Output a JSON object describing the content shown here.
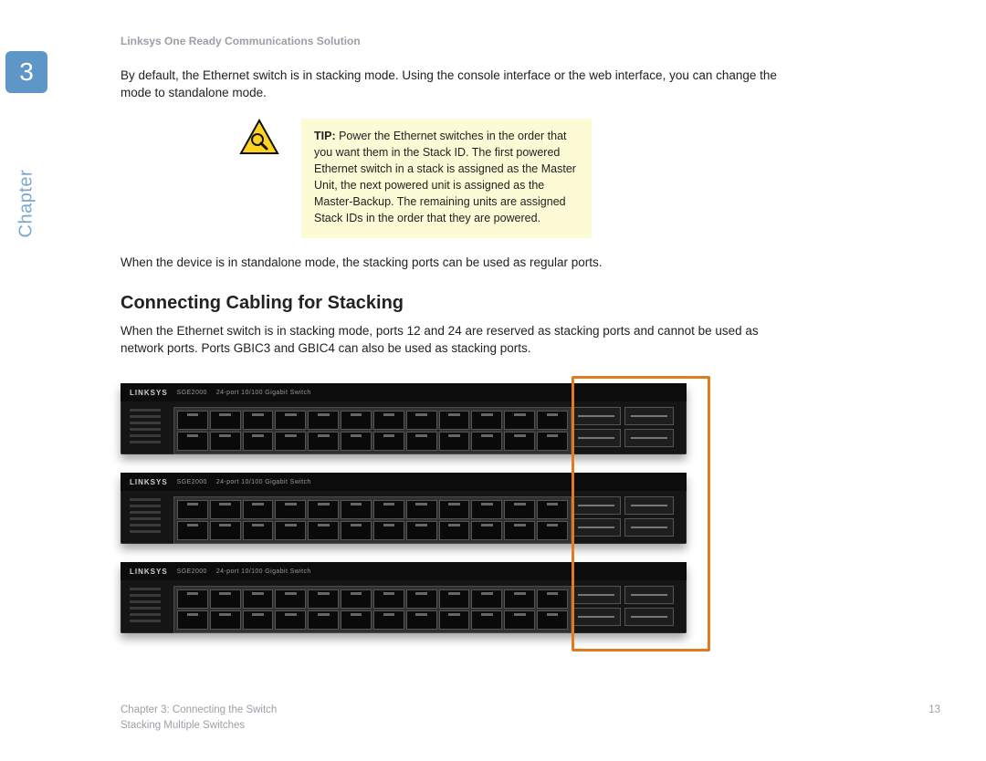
{
  "sideTab": {
    "chapterNumber": "3",
    "label": "Chapter"
  },
  "header": {
    "runningHead": "Linksys One Ready Communications Solution"
  },
  "body": {
    "intro": "By default, the Ethernet switch is in stacking mode. Using the console interface or the web interface, you can change the mode to standalone mode.",
    "tip": {
      "label": "TIP:",
      "text": "Power the Ethernet switches in the order that you want them in the Stack ID. The first powered Ethernet switch in a stack is assigned as the Master Unit, the next powered unit is assigned as the Master-Backup. The remaining units are assigned Stack IDs in the order that they are powered."
    },
    "standalone": "When the device is in standalone mode, the stacking ports can be used as regular ports.",
    "sectionTitle": "Connecting Cabling for Stacking",
    "sectionBody": "When the Ethernet switch is in stacking mode, ports 12 and 24 are reserved as stacking ports and cannot be used as network ports. Ports GBIC3 and GBIC4 can also be used as stacking ports."
  },
  "switchLabel": {
    "brand": "LINKSYS",
    "model": "SGE2000",
    "desc": "24-port 10/100 Gigabit Switch"
  },
  "footer": {
    "chapter": "Chapter 3: Connecting the Switch",
    "section": "Stacking Multiple Switches",
    "page": "13"
  }
}
